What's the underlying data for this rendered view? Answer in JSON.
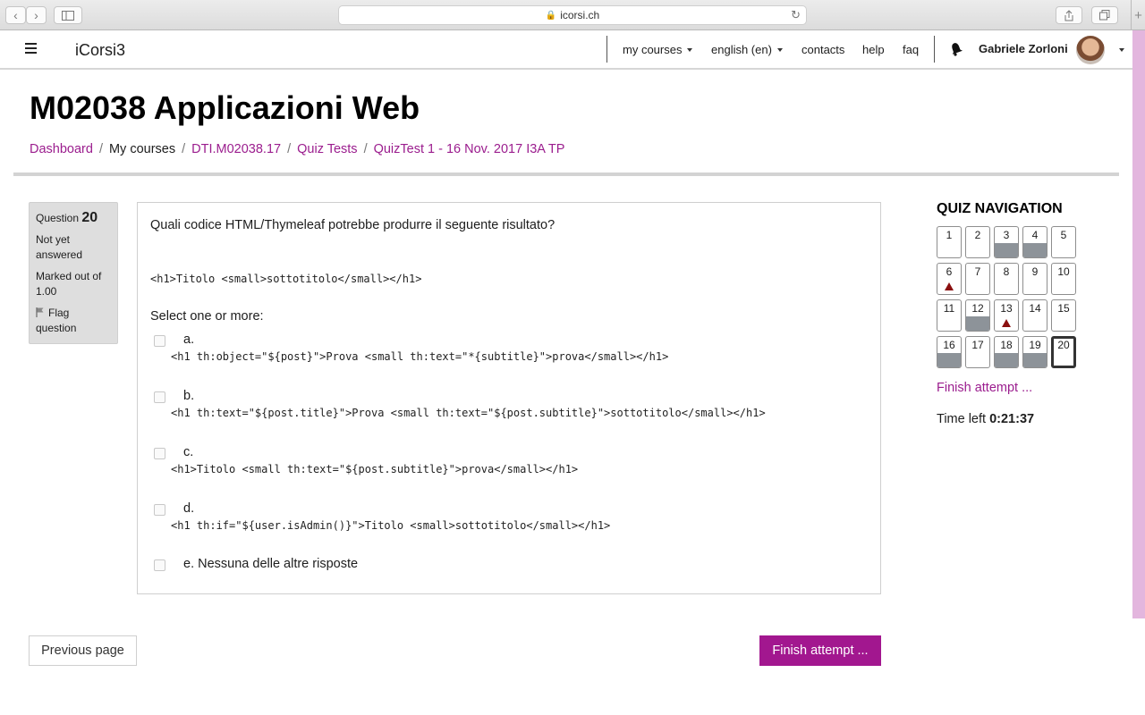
{
  "browser": {
    "url": "icorsi.ch",
    "icons": [
      "back-icon",
      "forward-icon",
      "sidebar-icon",
      "lock-icon",
      "reload-icon",
      "share-icon",
      "tabs-icon",
      "new-tab-icon"
    ]
  },
  "navbar": {
    "brand": "iCorsi3",
    "links": {
      "my_courses": "my courses",
      "language": "english (en)",
      "contacts": "contacts",
      "help": "help",
      "faq": "faq"
    },
    "user_name": "Gabriele Zorloni"
  },
  "header": {
    "title": "M02038 Applicazioni Web",
    "breadcrumb": [
      "Dashboard",
      "My courses",
      "DTI.M02038.17",
      "Quiz Tests",
      "QuizTest 1 - 16 Nov. 2017 I3A TP"
    ],
    "breadcrumb_sep": "/"
  },
  "question_info": {
    "label": "Question",
    "number": "20",
    "status": "Not yet answered",
    "marked": "Marked out of 1.00",
    "flag": "Flag question"
  },
  "question": {
    "text": "Quali codice HTML/Thymeleaf potrebbe produrre il seguente risultato?",
    "code": "<h1>Titolo <small>sottotitolo</small></h1>",
    "select_label": "Select one or more:",
    "options": [
      {
        "label": "a.",
        "code": "<h1 th:object=\"${post}\">Prova <small th:text=\"*{subtitle}\">prova</small></h1>"
      },
      {
        "label": "b.",
        "code": "<h1 th:text=\"${post.title}\">Prova <small th:text=\"${post.subtitle}\">sottotitolo</small></h1>"
      },
      {
        "label": "c.",
        "code": "<h1>Titolo <small th:text=\"${post.subtitle}\">prova</small></h1>"
      },
      {
        "label": "d.",
        "code": "<h1 th:if=\"${user.isAdmin()}\">Titolo <small>sottotitolo</small></h1>"
      },
      {
        "label": "e. Nessuna delle altre risposte",
        "code": ""
      }
    ]
  },
  "quiz_nav": {
    "title": "QUIZ NAVIGATION",
    "items": [
      {
        "n": "1",
        "state": "empty"
      },
      {
        "n": "2",
        "state": "empty"
      },
      {
        "n": "3",
        "state": "answered"
      },
      {
        "n": "4",
        "state": "answered"
      },
      {
        "n": "5",
        "state": "empty"
      },
      {
        "n": "6",
        "state": "flagged"
      },
      {
        "n": "7",
        "state": "empty"
      },
      {
        "n": "8",
        "state": "empty"
      },
      {
        "n": "9",
        "state": "empty"
      },
      {
        "n": "10",
        "state": "empty"
      },
      {
        "n": "11",
        "state": "empty"
      },
      {
        "n": "12",
        "state": "answered"
      },
      {
        "n": "13",
        "state": "flagged"
      },
      {
        "n": "14",
        "state": "empty"
      },
      {
        "n": "15",
        "state": "empty"
      },
      {
        "n": "16",
        "state": "answered"
      },
      {
        "n": "17",
        "state": "empty"
      },
      {
        "n": "18",
        "state": "answered"
      },
      {
        "n": "19",
        "state": "answered"
      },
      {
        "n": "20",
        "state": "current"
      }
    ],
    "finish_link": "Finish attempt ...",
    "time_label": "Time left",
    "time_value": "0:21:37"
  },
  "footer": {
    "prev": "Previous page",
    "finish": "Finish attempt ..."
  },
  "colors": {
    "accent": "#9b1d8e",
    "finish_button": "#a2178f",
    "answered_fill": "#8d9399",
    "flag": "#8a0f0f"
  }
}
